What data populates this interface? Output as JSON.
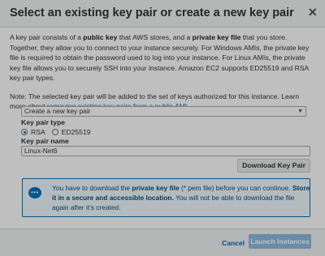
{
  "dialog": {
    "title": "Select an existing key pair or create a new key pair",
    "close_symbol": "×"
  },
  "intro": {
    "p1_a": "A key pair consists of a ",
    "p1_b": "public key",
    "p1_c": " that AWS stores, and a ",
    "p1_d": "private key file",
    "p1_e": " that you store. Together, they allow you to connect to your instance securely. For Windows AMIs, the private key file is required to obtain the password used to log into your instance. For Linux AMIs, the private key file allows you to securely SSH into your instance. Amazon EC2 supports ED25519 and RSA key pair types."
  },
  "note": {
    "text": "Note: The selected key pair will be added to the set of keys authorized for this instance. Learn more about ",
    "link": "removing existing key pairs from a public AMI",
    "suffix": "."
  },
  "select": {
    "value": "Create a new key pair",
    "arrow": "▼"
  },
  "key_type": {
    "label": "Key pair type",
    "options": [
      "RSA",
      "ED25519"
    ],
    "selected": "RSA"
  },
  "key_name": {
    "label": "Key pair name",
    "value": "Linux-Net6"
  },
  "download_button": "Download Key Pair",
  "info": {
    "icon_glyph": "•••",
    "t1": "You have to download the ",
    "t2": "private key file",
    "t3": " (*.pem file) before you can continue. ",
    "t4": "Store it in a secure and accessible location.",
    "t5": " You will not be able to download the file again after it's created."
  },
  "footer": {
    "cancel": "Cancel",
    "launch": "Launch Instances"
  }
}
